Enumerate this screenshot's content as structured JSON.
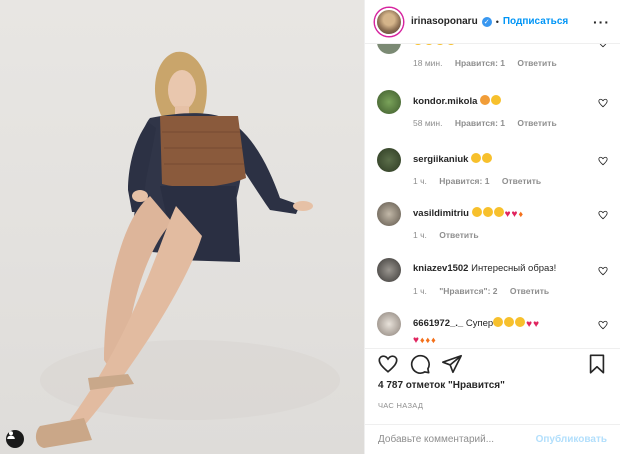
{
  "post": {
    "tag_icon": "user-tag-icon"
  },
  "header": {
    "username": "irinasoponaru",
    "verified": true,
    "separator": "•",
    "follow_label": "Подписаться",
    "more_icon": "more-horizontal-icon"
  },
  "comments": [
    {
      "username": "",
      "text": "",
      "emoji": [
        "grin",
        "grin",
        "grin",
        "grin"
      ],
      "time": "18 мин.",
      "likes": "Нравится: 1",
      "reply": "Ответить"
    },
    {
      "username": "kondor.mikola",
      "text": "",
      "emoji": [
        "cat",
        "grin"
      ],
      "time": "58 мин.",
      "likes": "Нравится: 1",
      "reply": "Ответить"
    },
    {
      "username": "sergiikaniuk",
      "text": "",
      "emoji": [
        "grin",
        "grin"
      ],
      "time": "1 ч.",
      "likes": "Нравится: 1",
      "reply": "Ответить"
    },
    {
      "username": "vasildimitriu",
      "text": "",
      "emoji": [
        "grin",
        "grin",
        "grin",
        "heart",
        "heart",
        "fire"
      ],
      "time": "1 ч.",
      "likes": "",
      "reply": "Ответить"
    },
    {
      "username": "kniazev1502",
      "text": "Интересный образ!",
      "emoji": [],
      "time": "1 ч.",
      "likes": "\"Нравится\": 2",
      "reply": "Ответить"
    },
    {
      "username": "6661972_._",
      "text": "Супер",
      "emoji": [
        "grin",
        "grin",
        "grin",
        "heart",
        "heart"
      ],
      "emoji_line2": [
        "fire",
        "fire",
        "fire",
        "fire"
      ],
      "time": "",
      "likes": "",
      "reply": ""
    }
  ],
  "actions": {
    "like_icon": "heart-outline-icon",
    "comment_icon": "comment-icon",
    "share_icon": "paper-plane-icon",
    "save_icon": "bookmark-icon"
  },
  "likes_text": "4 787 отметок \"Нравится\"",
  "time_ago": "ЧАС НАЗАД",
  "add_comment": {
    "placeholder": "Добавьте комментарий...",
    "publish_label": "Опубликовать"
  },
  "colors": {
    "link_blue": "#0095f6",
    "publish_disabled": "#b2dffc",
    "muted": "#8e8e8e",
    "heart": "#e0245e"
  }
}
